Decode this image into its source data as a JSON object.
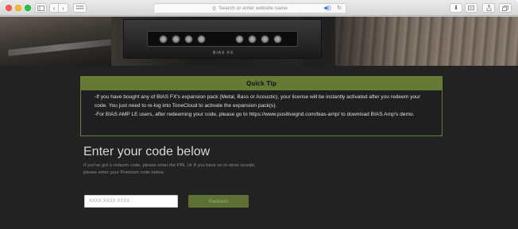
{
  "browser": {
    "address_placeholder": "Search or enter website name",
    "sound_icon": "speaker-icon",
    "reload_icon": "reload-icon"
  },
  "hero": {
    "brand": "BIAS FX"
  },
  "quick_tip": {
    "title": "Quick Tip",
    "lines": [
      "-If you have bought any of BIAS FX's expansion pack (Metal, Bass or Acoustic), your license will be instantly activated after you redeem your",
      "code. You just need to re-log into ToneCloud to activate the expansion pack(s).",
      "-For BIAS AMP LE users, after redeeming your code, please go to https://www.positivegrid.com/bias-amp/ to download BIAS Amp's demo."
    ]
  },
  "redeem": {
    "title": "Enter your code below",
    "desc_line1": "If you've got a redeem code, please enter the PIN. Or if you have an in-store receipt,",
    "desc_line2": "please enter your Premium code below.",
    "input_placeholder": "XXXX XXXX XXXX",
    "button_label": "Redeem"
  },
  "colors": {
    "accent": "#667a36",
    "page_bg": "#222222"
  }
}
